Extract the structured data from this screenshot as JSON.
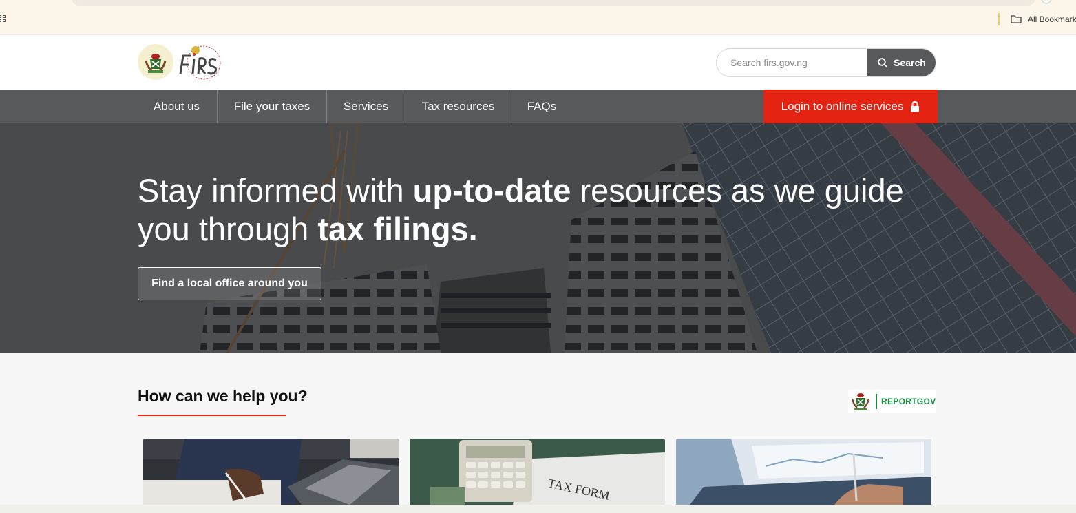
{
  "browser": {
    "bookmarks_label": "All Bookmarks"
  },
  "header": {
    "search": {
      "placeholder": "Search firs.gov.ng",
      "button_label": "Search"
    }
  },
  "nav": {
    "items": [
      {
        "label": "About us"
      },
      {
        "label": "File your taxes"
      },
      {
        "label": "Services"
      },
      {
        "label": "Tax resources"
      },
      {
        "label": "FAQs"
      }
    ],
    "login_label": "Login to online services"
  },
  "hero": {
    "title_part1": "Stay informed with ",
    "title_bold1": "up-to-date",
    "title_part2": " resources as we guide you through ",
    "title_bold2": "tax filings.",
    "button_label": "Find a local office around you"
  },
  "help": {
    "title": "How can we help you?",
    "reportgov_label": "REPORTGOV",
    "cards": [
      {
        "name": "person-signing-document-image"
      },
      {
        "name": "tax-form-calculator-image"
      },
      {
        "name": "laptop-analytics-image"
      }
    ]
  },
  "colors": {
    "nav_gray": "#58595b",
    "accent_red": "#e42313",
    "reportgov_green": "#138a3c"
  }
}
